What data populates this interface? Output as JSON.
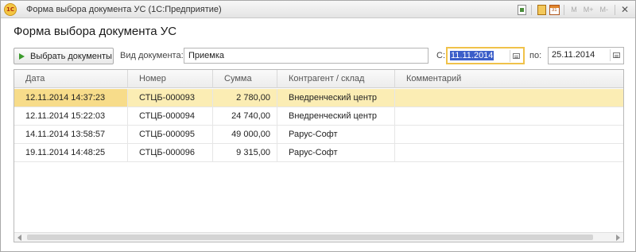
{
  "window": {
    "title": "Форма выбора документа УС  (1С:Предприятие)",
    "logo_text": "1С",
    "toolbar_icons": [
      "document-icon",
      "calculator-icon",
      "calendar-icon"
    ],
    "memory_buttons": [
      "M",
      "M+",
      "M-"
    ],
    "close_icon": "close-icon"
  },
  "form": {
    "title": "Форма выбора документа УС",
    "select_button_label": "Выбрать документы",
    "doc_type_label": "Вид документа:",
    "doc_type_value": "Приемка",
    "date_from_label": "С:",
    "date_from_value": "11.11.2014",
    "date_to_label": "по:",
    "date_to_value": "25.11.2014"
  },
  "table": {
    "columns": [
      "Дата",
      "Номер",
      "Сумма",
      "Контрагент / склад",
      "Комментарий"
    ],
    "rows": [
      {
        "date": "12.11.2014 14:37:23",
        "number": "СТЦБ-000093",
        "sum": "2 780,00",
        "counterparty": "Внедренческий центр",
        "comment": "",
        "selected": true
      },
      {
        "date": "12.11.2014 15:22:03",
        "number": "СТЦБ-000094",
        "sum": "24 740,00",
        "counterparty": "Внедренческий центр",
        "comment": "",
        "selected": false
      },
      {
        "date": "14.11.2014 13:58:57",
        "number": "СТЦБ-000095",
        "sum": "49 000,00",
        "counterparty": "Рарус-Софт",
        "comment": "",
        "selected": false
      },
      {
        "date": "19.11.2014 14:48:25",
        "number": "СТЦБ-000096",
        "sum": "9 315,00",
        "counterparty": "Рарус-Софт",
        "comment": "",
        "selected": false
      }
    ]
  },
  "colors": {
    "selected_row": "#fbedb4",
    "focus_border": "#f0c24a",
    "selection_highlight": "#3b5ec9"
  }
}
